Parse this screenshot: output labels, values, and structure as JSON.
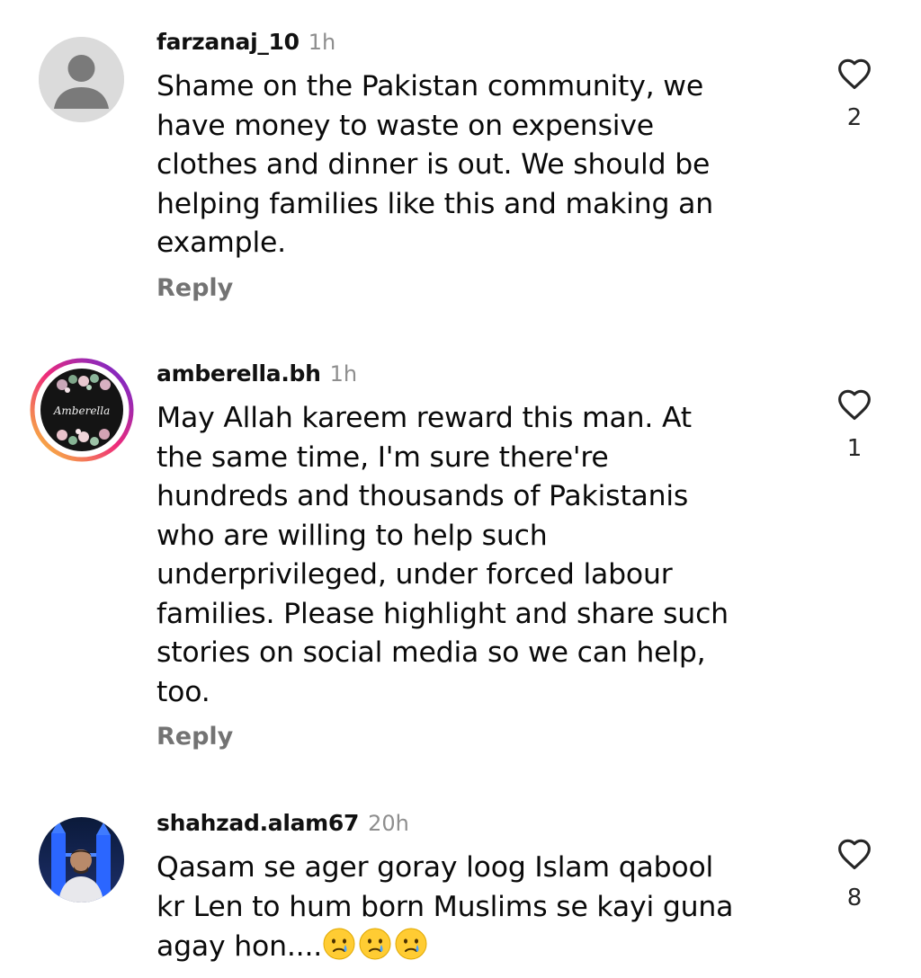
{
  "comments": [
    {
      "username": "farzanaj_10",
      "time": "1h",
      "text": "Shame on the Pakistan community, we\nhave money to waste on expensive\nclothes and dinner is out. We should be\nhelping families like this and making an\nexample.",
      "reply_label": "Reply",
      "like_count": "2",
      "avatar_icon": "default-avatar-icon"
    },
    {
      "username": "amberella.bh",
      "time": "1h",
      "text": "May Allah kareem reward this man. At\nthe same time, I'm sure there're\nhundreds and thousands of Pakistanis\nwho are willing to help such\nunderprivileged,  under forced labour\nfamilies. Please highlight and share such\nstories on social media so we can help,\ntoo.",
      "reply_label": "Reply",
      "like_count": "1",
      "avatar_logo_text": "Amberella",
      "avatar_icon": "amberella-logo-avatar"
    },
    {
      "username": "shahzad.alam67",
      "time": "20h",
      "text": "Qasam se ager goray loog Islam qabool\nkr Len to hum born Muslims se kayi guna\nagay hon....",
      "emoji": "crying-face-emoji",
      "like_count": "8",
      "avatar_icon": "photo-avatar"
    }
  ],
  "colors": {
    "username": "#111111",
    "secondary": "#8e8e8e",
    "reply": "#737373",
    "story_ring_start": "#f9ce34",
    "story_ring_mid": "#ee2a7b",
    "story_ring_end": "#6228d7"
  },
  "icons": {
    "like": "heart-outline-icon"
  }
}
